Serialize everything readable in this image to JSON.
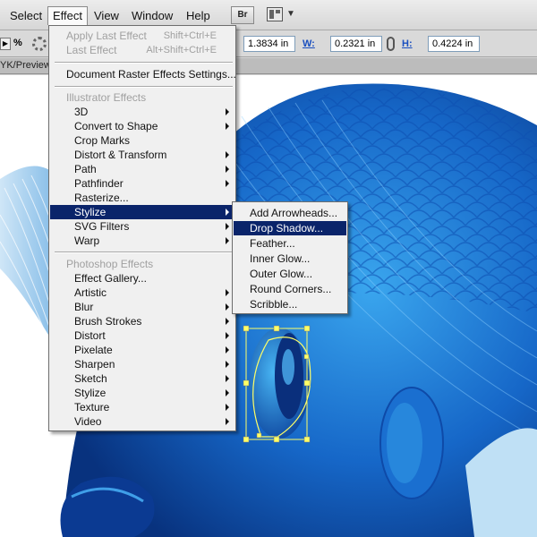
{
  "menubar": {
    "items": [
      "Select",
      "Effect",
      "View",
      "Window",
      "Help"
    ],
    "bridge_label": "Br"
  },
  "controlbar": {
    "percent": "%",
    "y_value": "1.3834 in",
    "w_label": "W:",
    "w_value": "0.2321 in",
    "h_label": "H:",
    "h_value": "0.4224 in"
  },
  "doc_tab": {
    "label": "YK/Preview"
  },
  "effect_menu": {
    "apply_last": {
      "label": "Apply Last Effect",
      "shortcut": "Shift+Ctrl+E"
    },
    "last_effect": {
      "label": "Last Effect",
      "shortcut": "Alt+Shift+Ctrl+E"
    },
    "doc_raster": "Document Raster Effects Settings...",
    "illustrator_header": "Illustrator Effects",
    "illustrator_items": [
      "3D",
      "Convert to Shape",
      "Crop Marks",
      "Distort & Transform",
      "Path",
      "Pathfinder",
      "Rasterize...",
      "Stylize",
      "SVG Filters",
      "Warp"
    ],
    "photoshop_header": "Photoshop Effects",
    "photoshop_items": [
      "Effect Gallery...",
      "Artistic",
      "Blur",
      "Brush Strokes",
      "Distort",
      "Pixelate",
      "Sharpen",
      "Sketch",
      "Stylize",
      "Texture",
      "Video"
    ]
  },
  "stylize_submenu": {
    "items": [
      "Add Arrowheads...",
      "Drop Shadow...",
      "Feather...",
      "Inner Glow...",
      "Outer Glow...",
      "Round Corners...",
      "Scribble..."
    ]
  },
  "colors": {
    "highlight": "#0a246a",
    "fish_dark": "#0a3f9a",
    "fish_light": "#2a8fe0",
    "selection": "#ffff66"
  },
  "icons": [
    "settings-gear-icon",
    "link-icon",
    "arrange-documents-icon",
    "chevron-down-icon",
    "submenu-arrow-icon"
  ]
}
